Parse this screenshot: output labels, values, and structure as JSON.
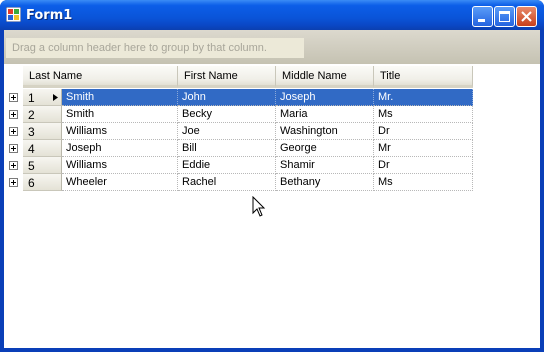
{
  "window": {
    "title": "Form1",
    "controls": [
      "minimize-icon",
      "maximize-icon",
      "close-icon"
    ]
  },
  "group_panel": {
    "hint": "Drag a column header here to group by that column."
  },
  "grid": {
    "columns": [
      "Last Name",
      "First Name",
      "Middle Name",
      "Title"
    ],
    "selected_row": 0,
    "rows": [
      {
        "num": "1",
        "cells": [
          "Smith",
          "John",
          "Joseph",
          "Mr."
        ]
      },
      {
        "num": "2",
        "cells": [
          "Smith",
          "Becky",
          "Maria",
          "Ms"
        ]
      },
      {
        "num": "3",
        "cells": [
          "Williams",
          "Joe",
          "Washington",
          "Dr"
        ]
      },
      {
        "num": "4",
        "cells": [
          "Joseph",
          "Bill",
          "George",
          "Mr"
        ]
      },
      {
        "num": "5",
        "cells": [
          "Williams",
          "Eddie",
          "Shamir",
          "Dr"
        ]
      },
      {
        "num": "6",
        "cells": [
          "Wheeler",
          "Rachel",
          "Bethany",
          "Ms"
        ]
      }
    ]
  },
  "colors": {
    "selection": "#316ac5",
    "titlebar": "#0a54d8"
  }
}
